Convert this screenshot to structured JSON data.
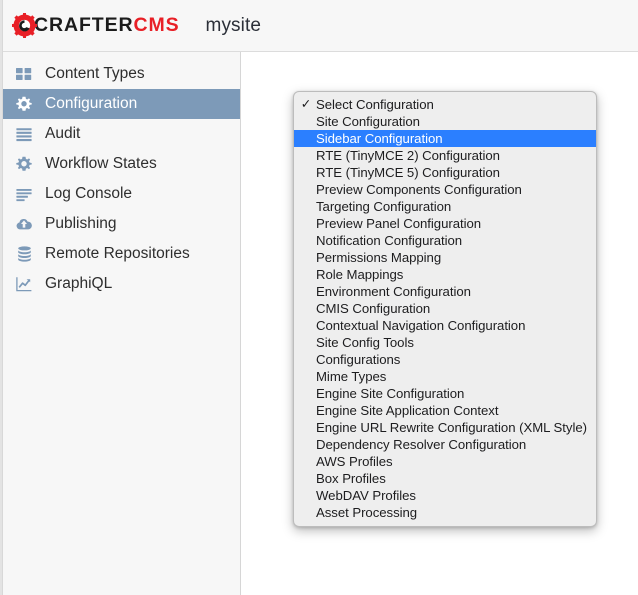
{
  "header": {
    "brand": {
      "icon": "crafter-gear-logo",
      "part1": "CRAFTER",
      "part2": "CMS",
      "color_primary": "#1c1c1c",
      "color_accent": "#e81f26"
    },
    "site_name": "mysite"
  },
  "sidebar": {
    "active_index": 1,
    "active_bg": "#7d9ab8",
    "icon_color": "#7d9ab8",
    "items": [
      {
        "label": "Content Types",
        "icon": "grid-squares-icon"
      },
      {
        "label": "Configuration",
        "icon": "gear-icon"
      },
      {
        "label": "Audit",
        "icon": "list-lines-icon"
      },
      {
        "label": "Workflow States",
        "icon": "gear-cog-icon"
      },
      {
        "label": "Log Console",
        "icon": "log-lines-icon"
      },
      {
        "label": "Publishing",
        "icon": "cloud-upload-icon"
      },
      {
        "label": "Remote Repositories",
        "icon": "database-stack-icon"
      },
      {
        "label": "GraphiQL",
        "icon": "chart-line-icon"
      }
    ]
  },
  "dropdown": {
    "name": "configuration-select-popup",
    "checked_index": 0,
    "selected_index": 2,
    "check_glyph": "✓",
    "highlight_color": "#2b7fff",
    "background_color": "#eeeeee",
    "options": [
      "Select Configuration",
      "Site Configuration",
      "Sidebar Configuration",
      "RTE (TinyMCE 2) Configuration",
      "RTE (TinyMCE 5) Configuration",
      "Preview Components Configuration",
      "Targeting Configuration",
      "Preview Panel Configuration",
      "Notification Configuration",
      "Permissions Mapping",
      "Role Mappings",
      "Environment Configuration",
      "CMIS Configuration",
      "Contextual Navigation Configuration",
      "Site Config Tools",
      "Configurations",
      "Mime Types",
      "Engine Site Configuration",
      "Engine Site Application Context",
      "Engine URL Rewrite Configuration (XML Style)",
      "Dependency Resolver Configuration",
      "AWS Profiles",
      "Box Profiles",
      "WebDAV Profiles",
      "Asset Processing"
    ]
  }
}
